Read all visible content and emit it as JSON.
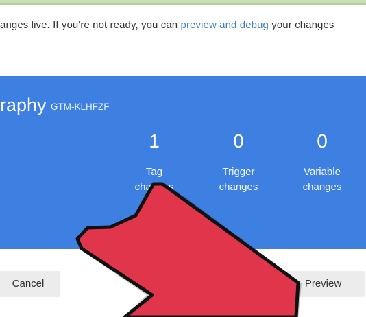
{
  "header": {
    "info_prefix": "anges live. If you're not ready, you can ",
    "info_link": "preview and debug",
    "info_suffix": " your changes"
  },
  "container": {
    "name": "raphy",
    "id": "GTM-KLHFZF",
    "stats": [
      {
        "count": "1",
        "label_line1": "Tag",
        "label_line2": "changes"
      },
      {
        "count": "0",
        "label_line1": "Trigger",
        "label_line2": "changes"
      },
      {
        "count": "0",
        "label_line1": "Variable",
        "label_line2": "changes"
      }
    ]
  },
  "actions": {
    "cancel_label": "Cancel",
    "preview_label": "Preview"
  },
  "colors": {
    "card_blue": "#3e7fe2",
    "link_blue": "#3b82c4",
    "arrow_red": "#e0354a",
    "top_bar_green": "#c8dfb5"
  },
  "overlay": {
    "icon": "red-arrow-pointer-icon"
  }
}
